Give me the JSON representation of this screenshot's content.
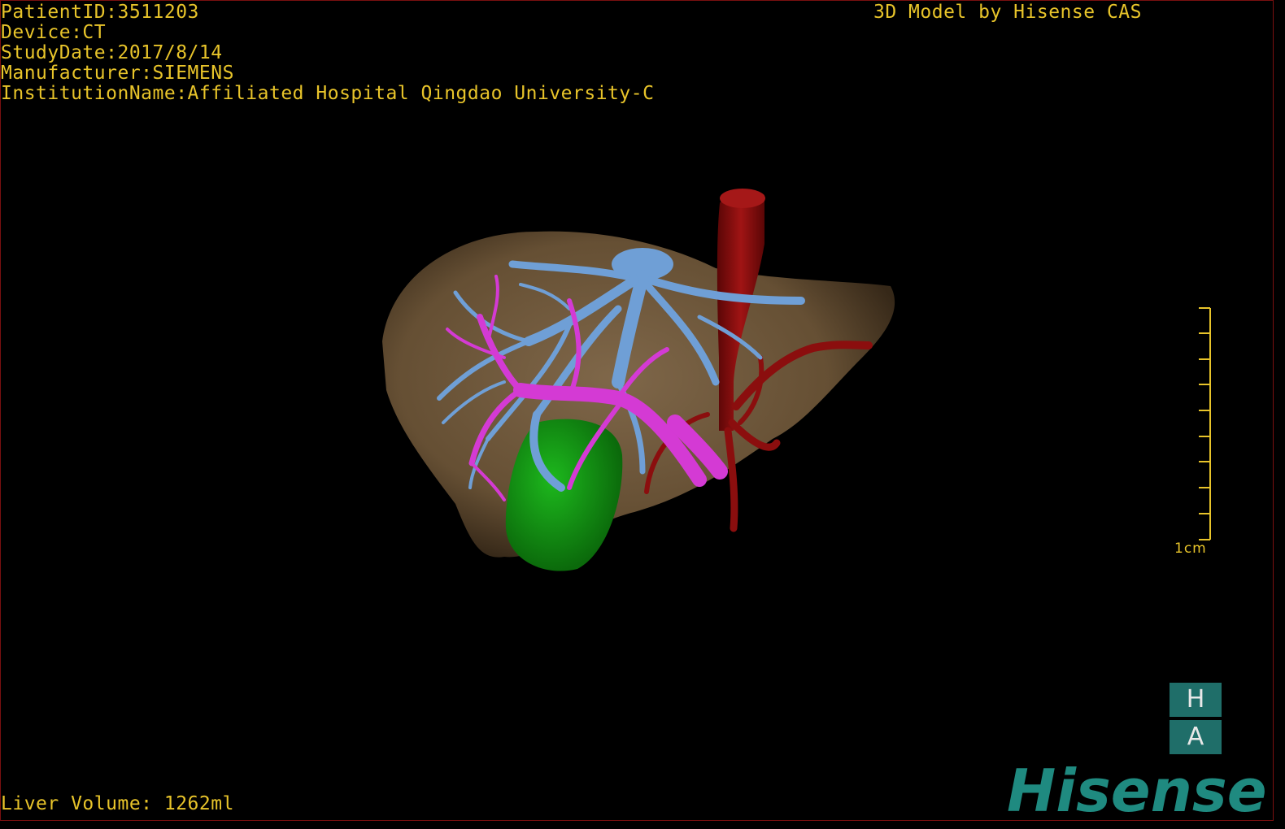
{
  "viewer": {
    "patient_id": "PatientID:3511203",
    "device": "Device:CT",
    "study_date": "StudyDate:2017/8/14",
    "manufacturer": "Manufacturer:SIEMENS",
    "institution": "InstitutionName:Affiliated Hospital Qingdao University-C",
    "credit": "3D Model by Hisense CAS",
    "liver_volume": "Liver Volume: 1262ml",
    "scale_label": "1cm",
    "orientation_top": "H",
    "orientation_bottom": "A",
    "brand": "Hisense"
  },
  "colors": {
    "overlay_text": "#e8c42a",
    "liver": "#7a6347",
    "hepatic_vein": "#6f9fd6",
    "portal_vein": "#d43ad4",
    "aorta": "#8b0e0e",
    "gallbladder": "#139413",
    "brand": "#1f8a80"
  },
  "icons": [
    "liver-3d-model",
    "scale-ruler",
    "orientation-cube",
    "hisense-logo"
  ]
}
